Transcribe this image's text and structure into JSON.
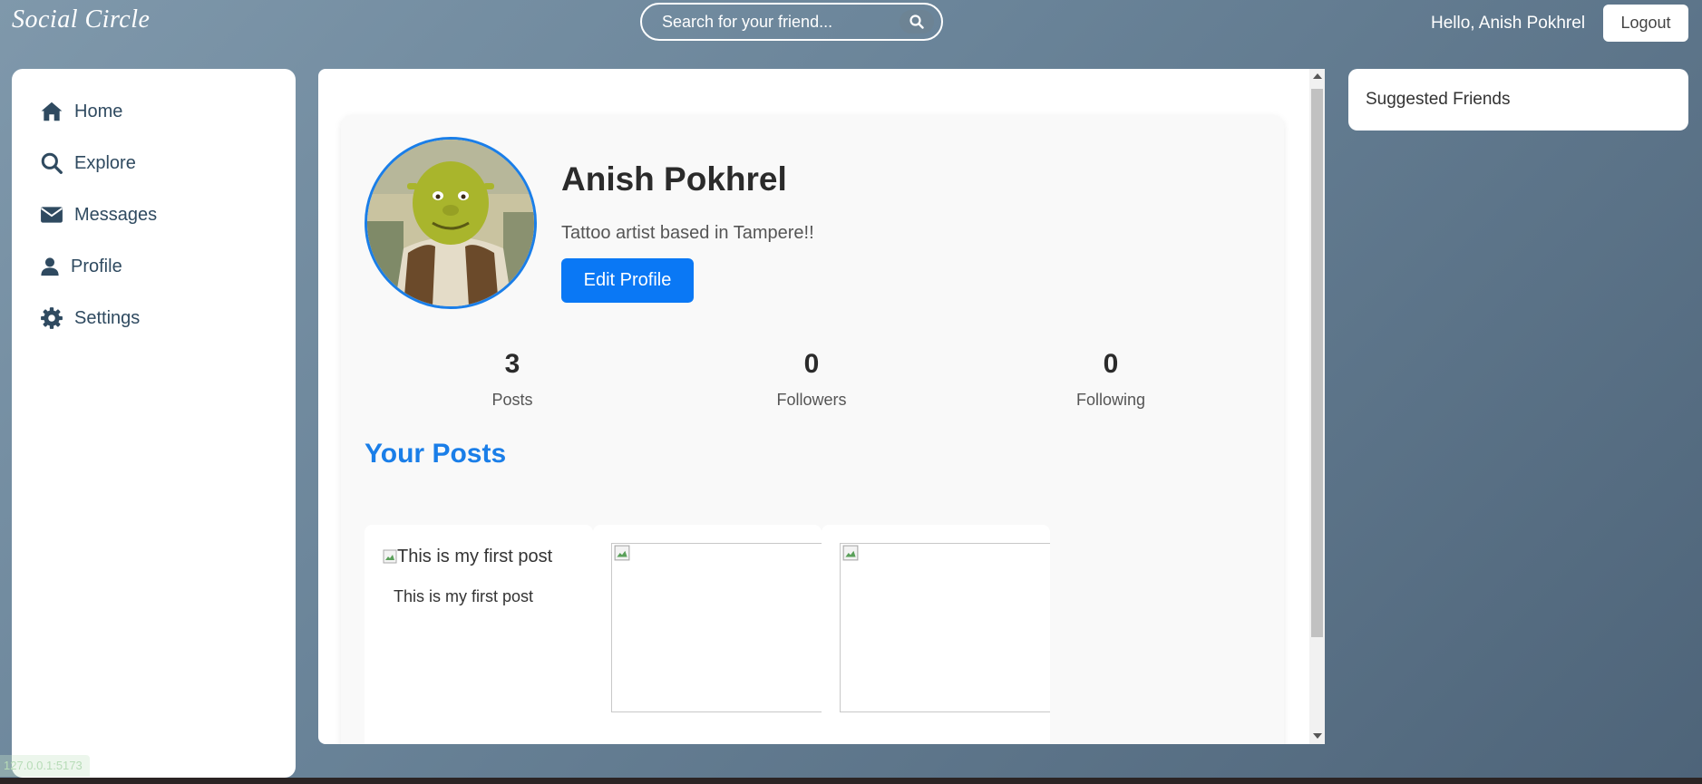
{
  "header": {
    "brand": "Social Circle",
    "search_placeholder": "Search for your friend...",
    "greeting": "Hello, Anish Pokhrel",
    "logout_label": "Logout"
  },
  "sidebar": {
    "items": [
      {
        "label": "Home",
        "icon": "home-icon"
      },
      {
        "label": "Explore",
        "icon": "search-icon"
      },
      {
        "label": "Messages",
        "icon": "envelope-icon"
      },
      {
        "label": "Profile",
        "icon": "user-icon"
      },
      {
        "label": "Settings",
        "icon": "gear-icon"
      }
    ]
  },
  "profile": {
    "name": "Anish Pokhrel",
    "bio": "Tattoo artist based in Tampere!!",
    "edit_label": "Edit Profile",
    "stats": [
      {
        "value": "3",
        "label": "Posts"
      },
      {
        "value": "0",
        "label": "Followers"
      },
      {
        "value": "0",
        "label": "Following"
      }
    ],
    "posts_title": "Your Posts",
    "posts": [
      {
        "alt": "This is my first post",
        "caption": "This is my first post"
      },
      {
        "alt": "",
        "caption": ""
      },
      {
        "alt": "",
        "caption": ""
      }
    ]
  },
  "suggested": {
    "title": "Suggested Friends"
  },
  "status": {
    "url": "127.0.0.1:5173"
  },
  "colors": {
    "accent": "#0a78f5",
    "title_blue": "#1a7ee8",
    "nav_text": "#2f4a60"
  }
}
